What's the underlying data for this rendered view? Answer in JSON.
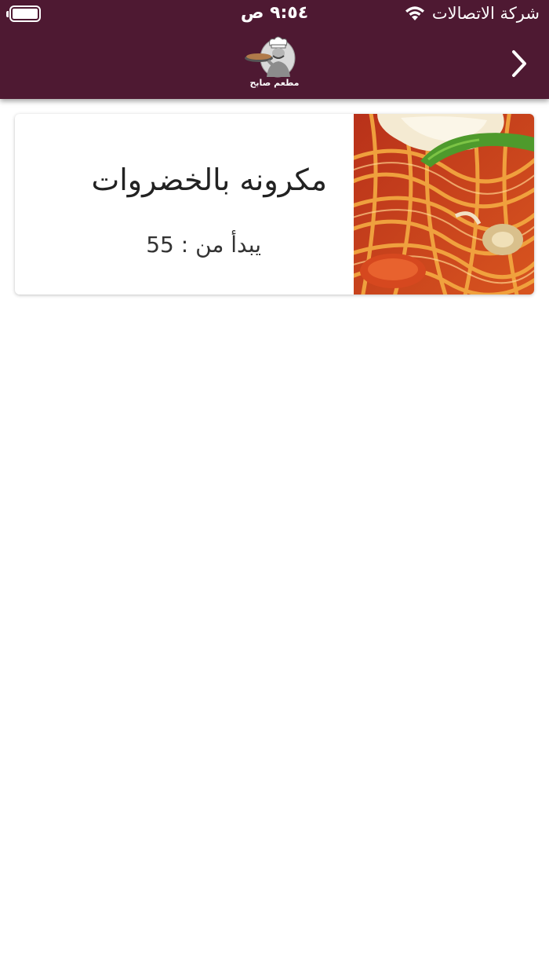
{
  "status_bar": {
    "carrier": "شركة الاتصالات",
    "time": "٩:٥٤ ص",
    "battery_level": 1.0
  },
  "nav": {
    "logo_text": "مطعم صابح",
    "back_icon": "chevron-right-icon"
  },
  "product": {
    "name": "مكرونه بالخضروات",
    "price_label": "يبدأ من : 55",
    "image_icon": "pasta-photo"
  },
  "colors": {
    "brand": "#4e1932",
    "card_bg": "#ffffff",
    "text": "#222222"
  }
}
